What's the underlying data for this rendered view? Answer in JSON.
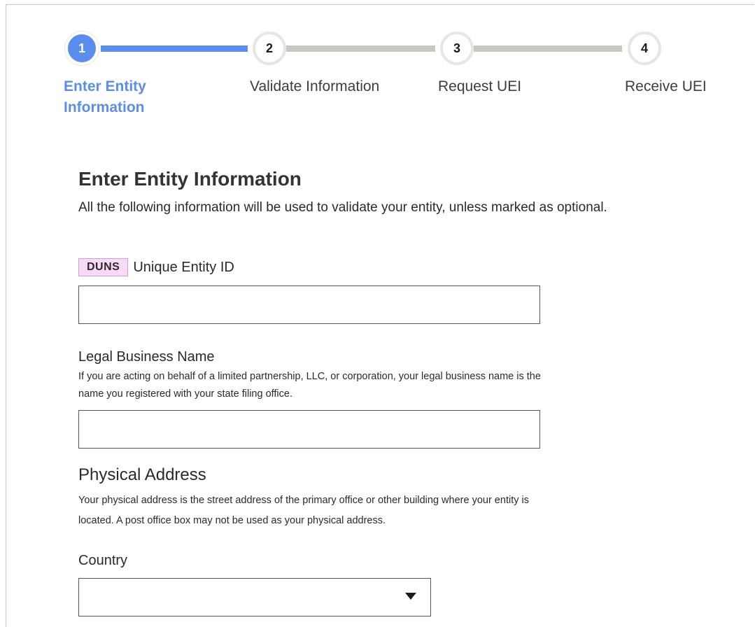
{
  "stepper": {
    "steps": [
      {
        "number": "1",
        "label_line1": "Enter Entity",
        "label_line2": "Information",
        "state": "active"
      },
      {
        "number": "2",
        "label": "Validate Information",
        "state": "pending"
      },
      {
        "number": "3",
        "label": "Request UEI",
        "state": "pending"
      },
      {
        "number": "4",
        "label": "Receive UEI",
        "state": "pending"
      }
    ]
  },
  "form": {
    "title": "Enter Entity Information",
    "subtitle": "All the following information will be used to validate your entity, unless marked as optional.",
    "uei": {
      "badge": "DUNS",
      "label": "Unique Entity ID",
      "value": ""
    },
    "legal_name": {
      "label": "Legal Business Name",
      "hint_line1": "If you are acting on behalf of a limited partnership, LLC, or corporation, your legal business name is the",
      "hint_line2": "name you registered with your state filing office.",
      "value": ""
    },
    "physical_address": {
      "heading": "Physical Address",
      "hint_line1": "Your physical address is the street address of the primary office or other building where your entity is",
      "hint_line2": "located. A post office box may not be used as your physical address."
    },
    "country": {
      "label": "Country",
      "selected": ""
    }
  },
  "colors": {
    "accent": "#5b8def",
    "pending_line": "#c9c8bf",
    "badge_bg": "#f8d9f8"
  }
}
